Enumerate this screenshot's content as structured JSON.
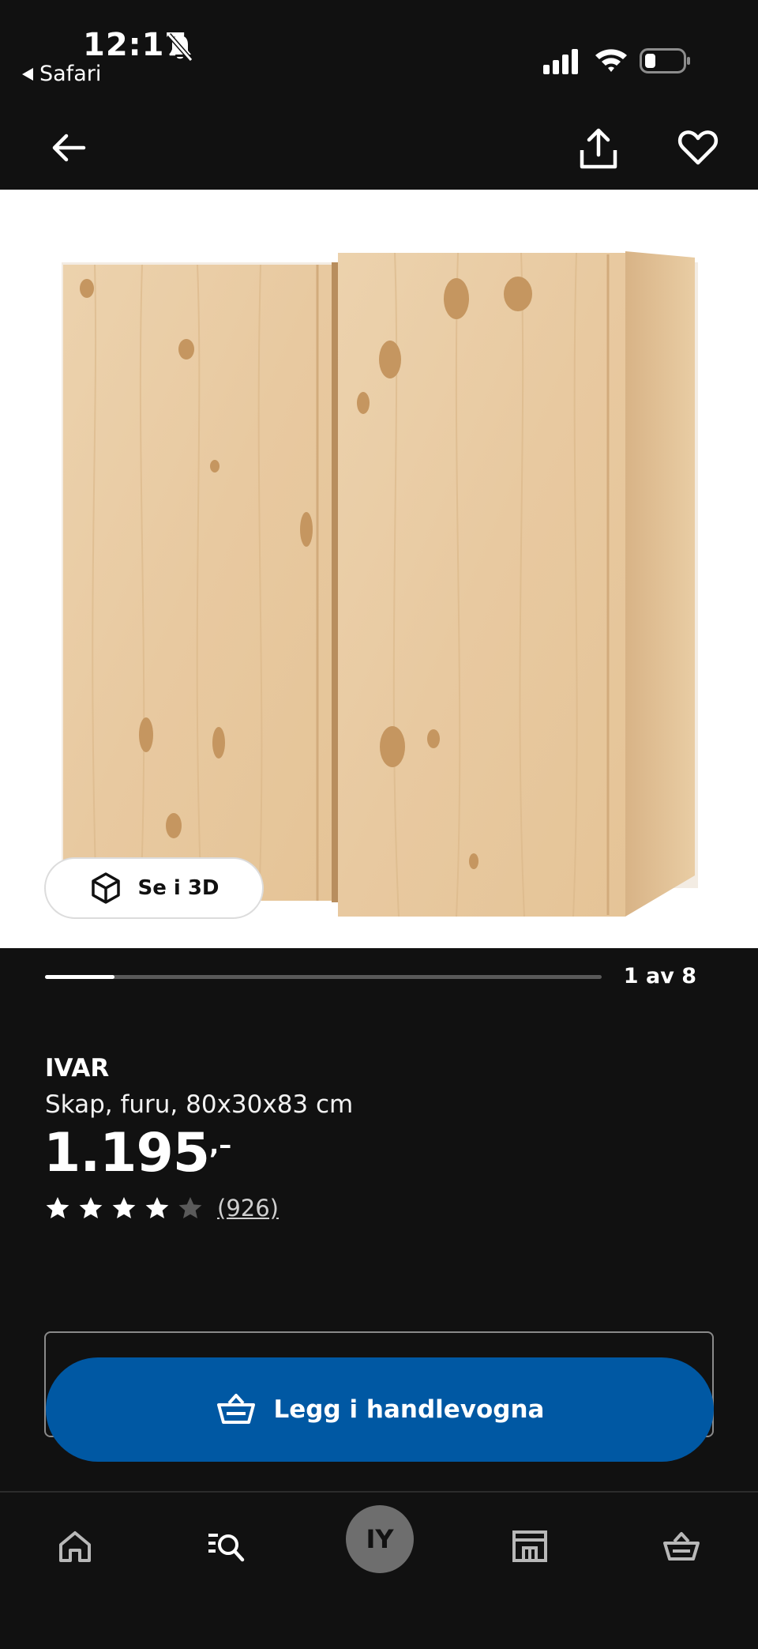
{
  "status_bar": {
    "time": "12:17",
    "back_app": "Safari"
  },
  "nav": {
    "back_icon": "arrow-left-icon",
    "share_icon": "share-icon",
    "favorite_icon": "heart-icon"
  },
  "gallery": {
    "view_3d_label": "Se i 3D",
    "position_text": "1 av 8",
    "current": 1,
    "total": 8
  },
  "product": {
    "name": "IVAR",
    "description": "Skap, furu, 80x30x83 cm",
    "price": "1.195",
    "price_suffix": ",–",
    "rating": 4,
    "rating_max": 5,
    "review_count": "(926)"
  },
  "cart": {
    "add_label": "Legg i handlevogna",
    "button_color": "#0058a3"
  },
  "tab_bar": {
    "profile_initials": "IY",
    "items": [
      "home-icon",
      "search-icon",
      "profile-avatar",
      "store-icon",
      "cart-icon"
    ]
  }
}
